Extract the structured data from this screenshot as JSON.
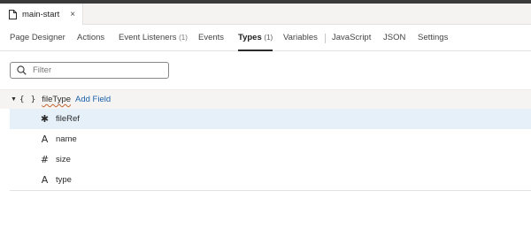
{
  "file_tab": {
    "title": "main-start",
    "close_glyph": "×",
    "icon": "document-icon"
  },
  "nav_tabs": [
    {
      "label": "Page Designer",
      "count": ""
    },
    {
      "label": "Actions",
      "count": ""
    },
    {
      "label": "Event Listeners",
      "count": "(1)"
    },
    {
      "label": "Events",
      "count": ""
    },
    {
      "label": "Types",
      "count": "(1)",
      "active": true
    },
    {
      "label": "Variables",
      "count": ""
    },
    {
      "label": "JavaScript",
      "count": ""
    },
    {
      "label": "JSON",
      "count": ""
    },
    {
      "label": "Settings",
      "count": ""
    }
  ],
  "filter": {
    "placeholder": "Filter",
    "value": "",
    "icon": "search-icon"
  },
  "tree": {
    "root": {
      "caret": "▼",
      "braces": "{ }",
      "name": "fileType",
      "add_field_label": "Add Field"
    },
    "fields": [
      {
        "icon": "asterisk-icon",
        "glyph": "✱",
        "name": "fileRef",
        "selected": true
      },
      {
        "icon": "string-type-icon",
        "glyph": "A",
        "name": "name"
      },
      {
        "icon": "number-type-icon",
        "glyph": "#",
        "name": "size"
      },
      {
        "icon": "string-type-icon",
        "glyph": "A",
        "name": "type"
      }
    ]
  },
  "colors": {
    "link": "#1b5fab",
    "selected_row": "#e6f0f8",
    "active_tab_underline": "#2b2b2b"
  }
}
